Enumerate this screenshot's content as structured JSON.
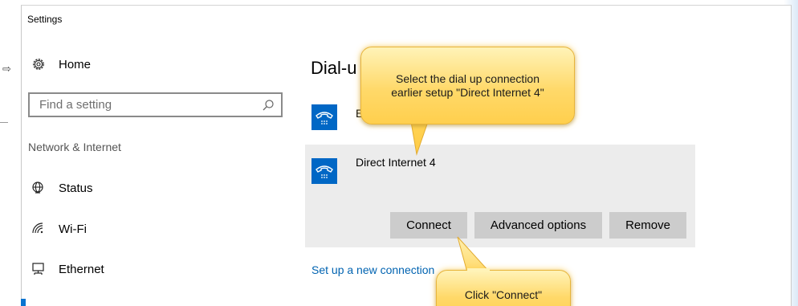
{
  "window": {
    "title": "Settings"
  },
  "sidebar": {
    "home_label": "Home",
    "search_placeholder": "Find a setting",
    "section_label": "Network & Internet",
    "items": [
      {
        "label": "Status",
        "icon": "globe-icon"
      },
      {
        "label": "Wi-Fi",
        "icon": "wifi-icon"
      },
      {
        "label": "Ethernet",
        "icon": "ethernet-icon"
      }
    ]
  },
  "main": {
    "title": "Dial-u",
    "connections": [
      {
        "name": "E",
        "icon": "dialup-phone-icon"
      },
      {
        "name": "Direct Internet 4",
        "icon": "dialup-phone-icon"
      }
    ],
    "buttons": {
      "connect": "Connect",
      "advanced": "Advanced options",
      "remove": "Remove"
    },
    "setup_link": "Set up a new connection"
  },
  "callouts": {
    "select": [
      "Select the dial up connection",
      "earlier setup \"Direct Internet 4\""
    ],
    "click": "Click \"Connect\""
  },
  "colors": {
    "accent": "#0067c5",
    "link": "#0063b1",
    "button": "#cccccc",
    "panel": "#ececec",
    "callout": "#ffd96a"
  }
}
